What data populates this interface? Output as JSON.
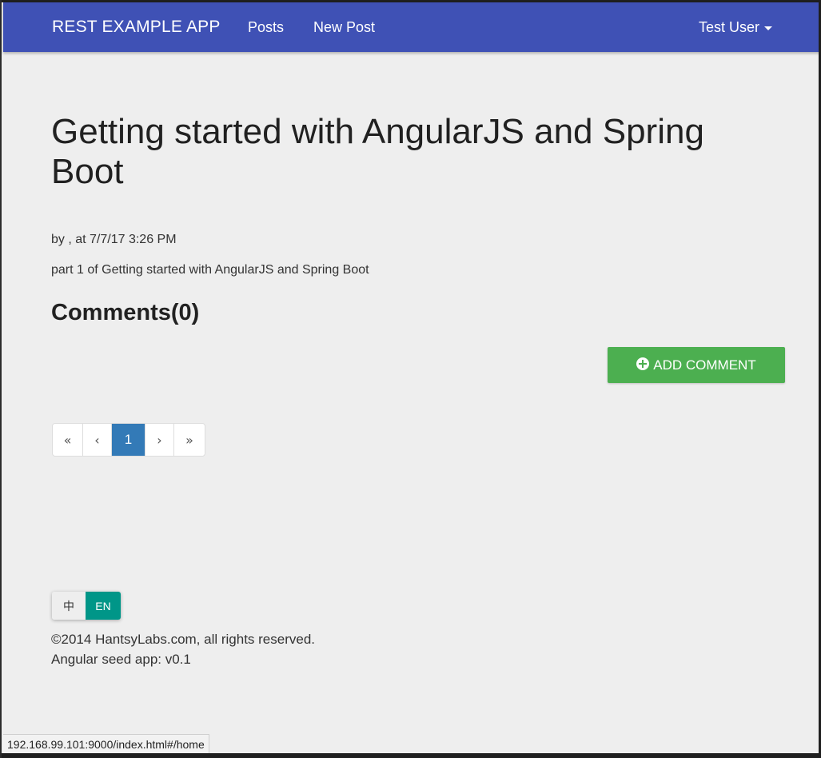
{
  "navbar": {
    "brand": "REST EXAMPLE APP",
    "links": [
      {
        "label": "Posts"
      },
      {
        "label": "New Post"
      }
    ],
    "user": "Test User"
  },
  "post": {
    "title": "Getting started with AngularJS and Spring Boot",
    "meta": "by , at 7/7/17 3:26 PM",
    "content": "part 1 of Getting started with AngularJS and Spring Boot"
  },
  "comments": {
    "heading": "Comments(0)",
    "add_label": "ADD COMMENT"
  },
  "pagination": {
    "first": "«",
    "prev": "‹",
    "current": "1",
    "next": "›",
    "last": "»"
  },
  "language": {
    "zh": "中",
    "en": "EN",
    "active": "EN"
  },
  "footer": {
    "copyright": "©2014 HantsyLabs.com, all rights reserved.",
    "version": "Angular seed app: v0.1"
  },
  "status_bar": {
    "url": "192.168.99.101:9000/index.html#/home"
  },
  "colors": {
    "navbar": "#3f51b5",
    "add_button": "#4caf50",
    "pagination_active": "#337ab7",
    "lang_active": "#009688",
    "background": "#eeeeee"
  }
}
